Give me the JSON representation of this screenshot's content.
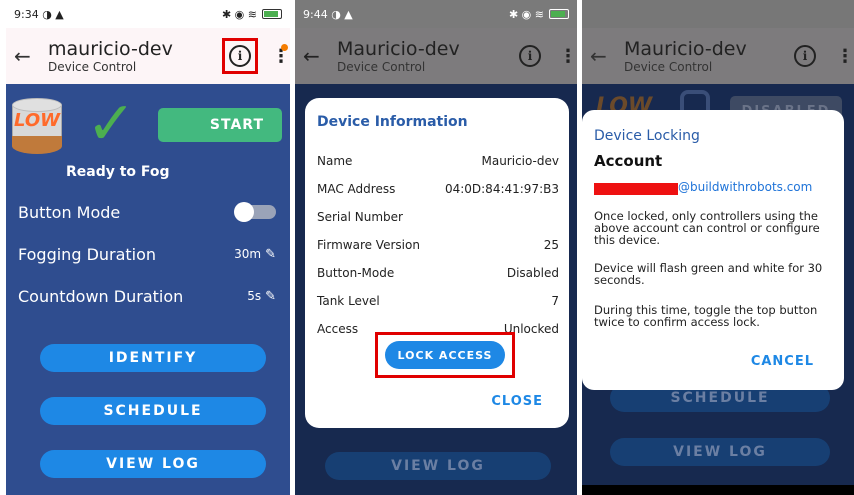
{
  "panel1": {
    "status": {
      "time": "9:34",
      "icons_left": "◑ ▲",
      "icons_right": "✱ ◉ ≋"
    },
    "appbar": {
      "back": "←",
      "title": "mauricio-dev",
      "subtitle": "Device Control",
      "info_icon": "i",
      "menu_icon": "⋮"
    },
    "tank_label": "LOW",
    "check_glyph": "✓",
    "start_label": "START",
    "ready_text": "Ready to Fog",
    "rows": [
      {
        "label": "Button Mode",
        "value": ""
      },
      {
        "label": "Fogging Duration",
        "value": "30m"
      },
      {
        "label": "Countdown Duration",
        "value": "5s"
      }
    ],
    "pencil_glyph": "✎",
    "buttons": {
      "identify": "IDENTIFY",
      "schedule": "SCHEDULE",
      "view_log": "VIEW LOG"
    }
  },
  "panel2": {
    "status": {
      "time": "9:44",
      "icons_left": "◑ ▲",
      "icons_right": "✱ ◉ ≋"
    },
    "appbar": {
      "back": "←",
      "title": "Mauricio-dev",
      "subtitle": "Device Control",
      "info_icon": "i",
      "menu_icon": "⋮"
    },
    "dialog": {
      "title": "Device Information",
      "fields": [
        {
          "label": "Name",
          "value": "Mauricio-dev"
        },
        {
          "label": "MAC Address",
          "value": "04:0D:84:41:97:B3"
        },
        {
          "label": "Serial Number",
          "value": ""
        },
        {
          "label": "Firmware Version",
          "value": "25"
        },
        {
          "label": "Button-Mode",
          "value": "Disabled"
        },
        {
          "label": "Tank Level",
          "value": "7"
        },
        {
          "label": "Access",
          "value": "Unlocked"
        }
      ],
      "lock_button": "LOCK ACCESS",
      "close_button": "CLOSE"
    },
    "background_button": "VIEW LOG"
  },
  "panel3": {
    "appbar": {
      "back": "←",
      "title": "Mauricio-dev",
      "subtitle": "Device Control",
      "info_icon": "i",
      "menu_icon": "⋮"
    },
    "tank_label": "LOW",
    "disabled_label": "DISABLED",
    "dialog": {
      "title": "Device Locking",
      "account_label": "Account",
      "email_suffix": "@buildwithrobots.com",
      "paragraphs": [
        "Once locked, only controllers using the above account can control or configure this device.",
        "Device will flash green and white for 30 seconds.",
        "During this time, toggle the top button twice to confirm access lock."
      ],
      "cancel_button": "CANCEL"
    },
    "background_buttons": {
      "schedule": "SCHEDULE",
      "view_log": "VIEW LOG"
    }
  },
  "colors": {
    "app_bg": "#2f4d8f",
    "accent_blue": "#1e88e5",
    "start_green": "#43b97f",
    "highlight_red": "#e00000",
    "link_blue": "#1e73d8"
  }
}
